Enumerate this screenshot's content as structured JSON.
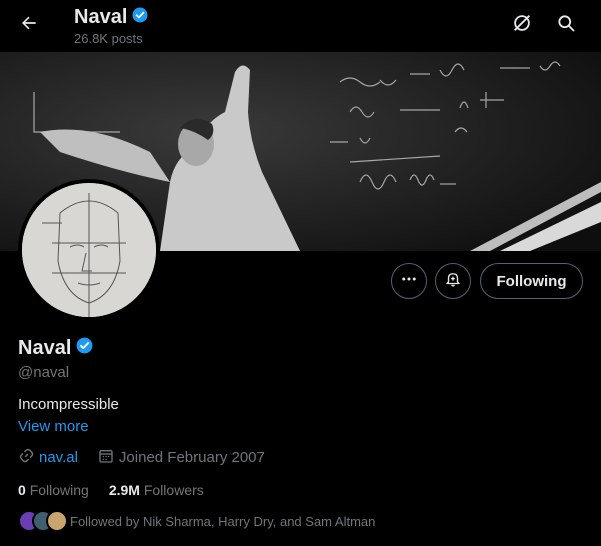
{
  "header": {
    "name": "Naval",
    "posts": "26.8K posts"
  },
  "icons": {
    "back": "arrow-left-icon",
    "grok": "grok-icon",
    "search": "search-icon",
    "verified": "verified-badge-icon",
    "more": "more-dots-icon",
    "notify": "bell-plus-icon",
    "link": "link-icon",
    "calendar": "calendar-icon"
  },
  "profile": {
    "name": "Naval",
    "handle": "@naval",
    "bio": "Incompressible",
    "view_more": "View more",
    "link": "nav.al",
    "joined": "Joined February 2007",
    "following_count": "0",
    "following_label": "Following",
    "followers_count": "2.9M",
    "followers_label": "Followers",
    "followed_by": "Followed by Nik Sharma, Harry Dry, and Sam Altman"
  },
  "actions": {
    "following_button": "Following"
  },
  "colors": {
    "accent": "#1d9bf0",
    "muted": "#71767b",
    "text": "#e7e9ea",
    "background": "#000000"
  }
}
